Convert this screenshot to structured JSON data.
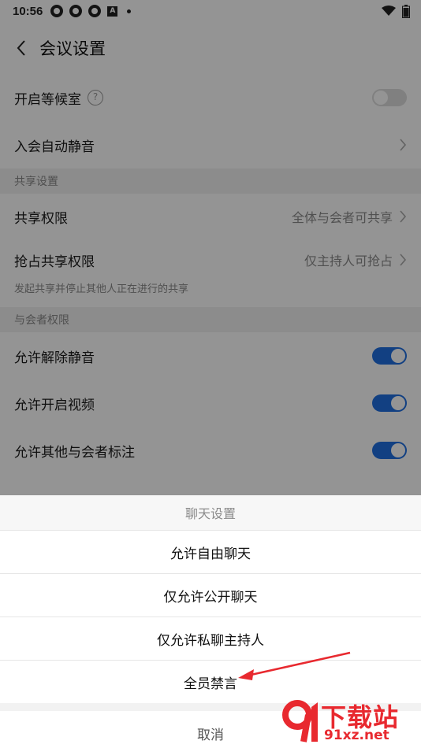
{
  "status_bar": {
    "time": "10:56",
    "a_label": "A"
  },
  "header": {
    "title": "会议设置"
  },
  "settings": {
    "waiting_room": "开启等候室",
    "waiting_room_help": "?",
    "auto_mute": "入会自动静音",
    "share_section": "共享设置",
    "share_permission_label": "共享权限",
    "share_permission_value": "全体与会者可共享",
    "grab_share_label": "抢占共享权限",
    "grab_share_value": "仅主持人可抢占",
    "grab_share_hint": "发起共享并停止其他人正在进行的共享",
    "participant_section": "与会者权限",
    "allow_unmute": "允许解除静音",
    "allow_video": "允许开启视频",
    "allow_annotate": "允许其他与会者标注"
  },
  "sheet": {
    "title": "聊天设置",
    "options": [
      "允许自由聊天",
      "仅允许公开聊天",
      "仅允许私聊主持人",
      "全员禁言"
    ],
    "cancel": "取消"
  },
  "watermark": {
    "brand": "下载站",
    "url": "91xz.net"
  },
  "colors": {
    "toggle_on": "#1f6fe0",
    "arrow": "#e8292f",
    "watermark": "#e8292f"
  }
}
